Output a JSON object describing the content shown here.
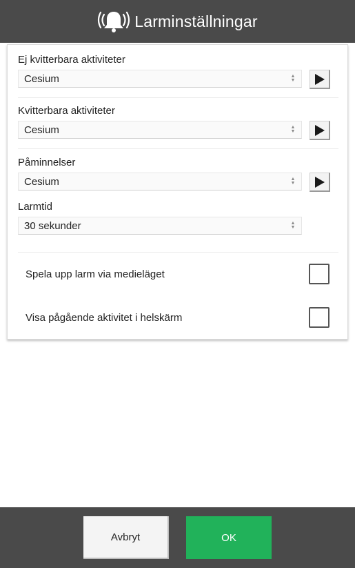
{
  "header": {
    "title": "Larminställningar",
    "icon": "alarm-bell-icon"
  },
  "settings": {
    "non_ack": {
      "label": "Ej kvitterbara aktiviteter",
      "value": "Cesium"
    },
    "ack": {
      "label": "Kvitterbara aktiviteter",
      "value": "Cesium"
    },
    "reminders": {
      "label": "Påminnelser",
      "value": "Cesium"
    },
    "alarm_time": {
      "label": "Larmtid",
      "value": "30 sekunder"
    }
  },
  "checkboxes": {
    "media_mode": {
      "label": "Spela upp larm via medieläget",
      "checked": false
    },
    "fullscreen": {
      "label": "Visa pågående aktivitet i helskärm",
      "checked": false
    }
  },
  "footer": {
    "cancel_label": "Avbryt",
    "ok_label": "OK"
  },
  "colors": {
    "header_bg": "#4a4a4a",
    "ok_green": "#21b25a"
  }
}
